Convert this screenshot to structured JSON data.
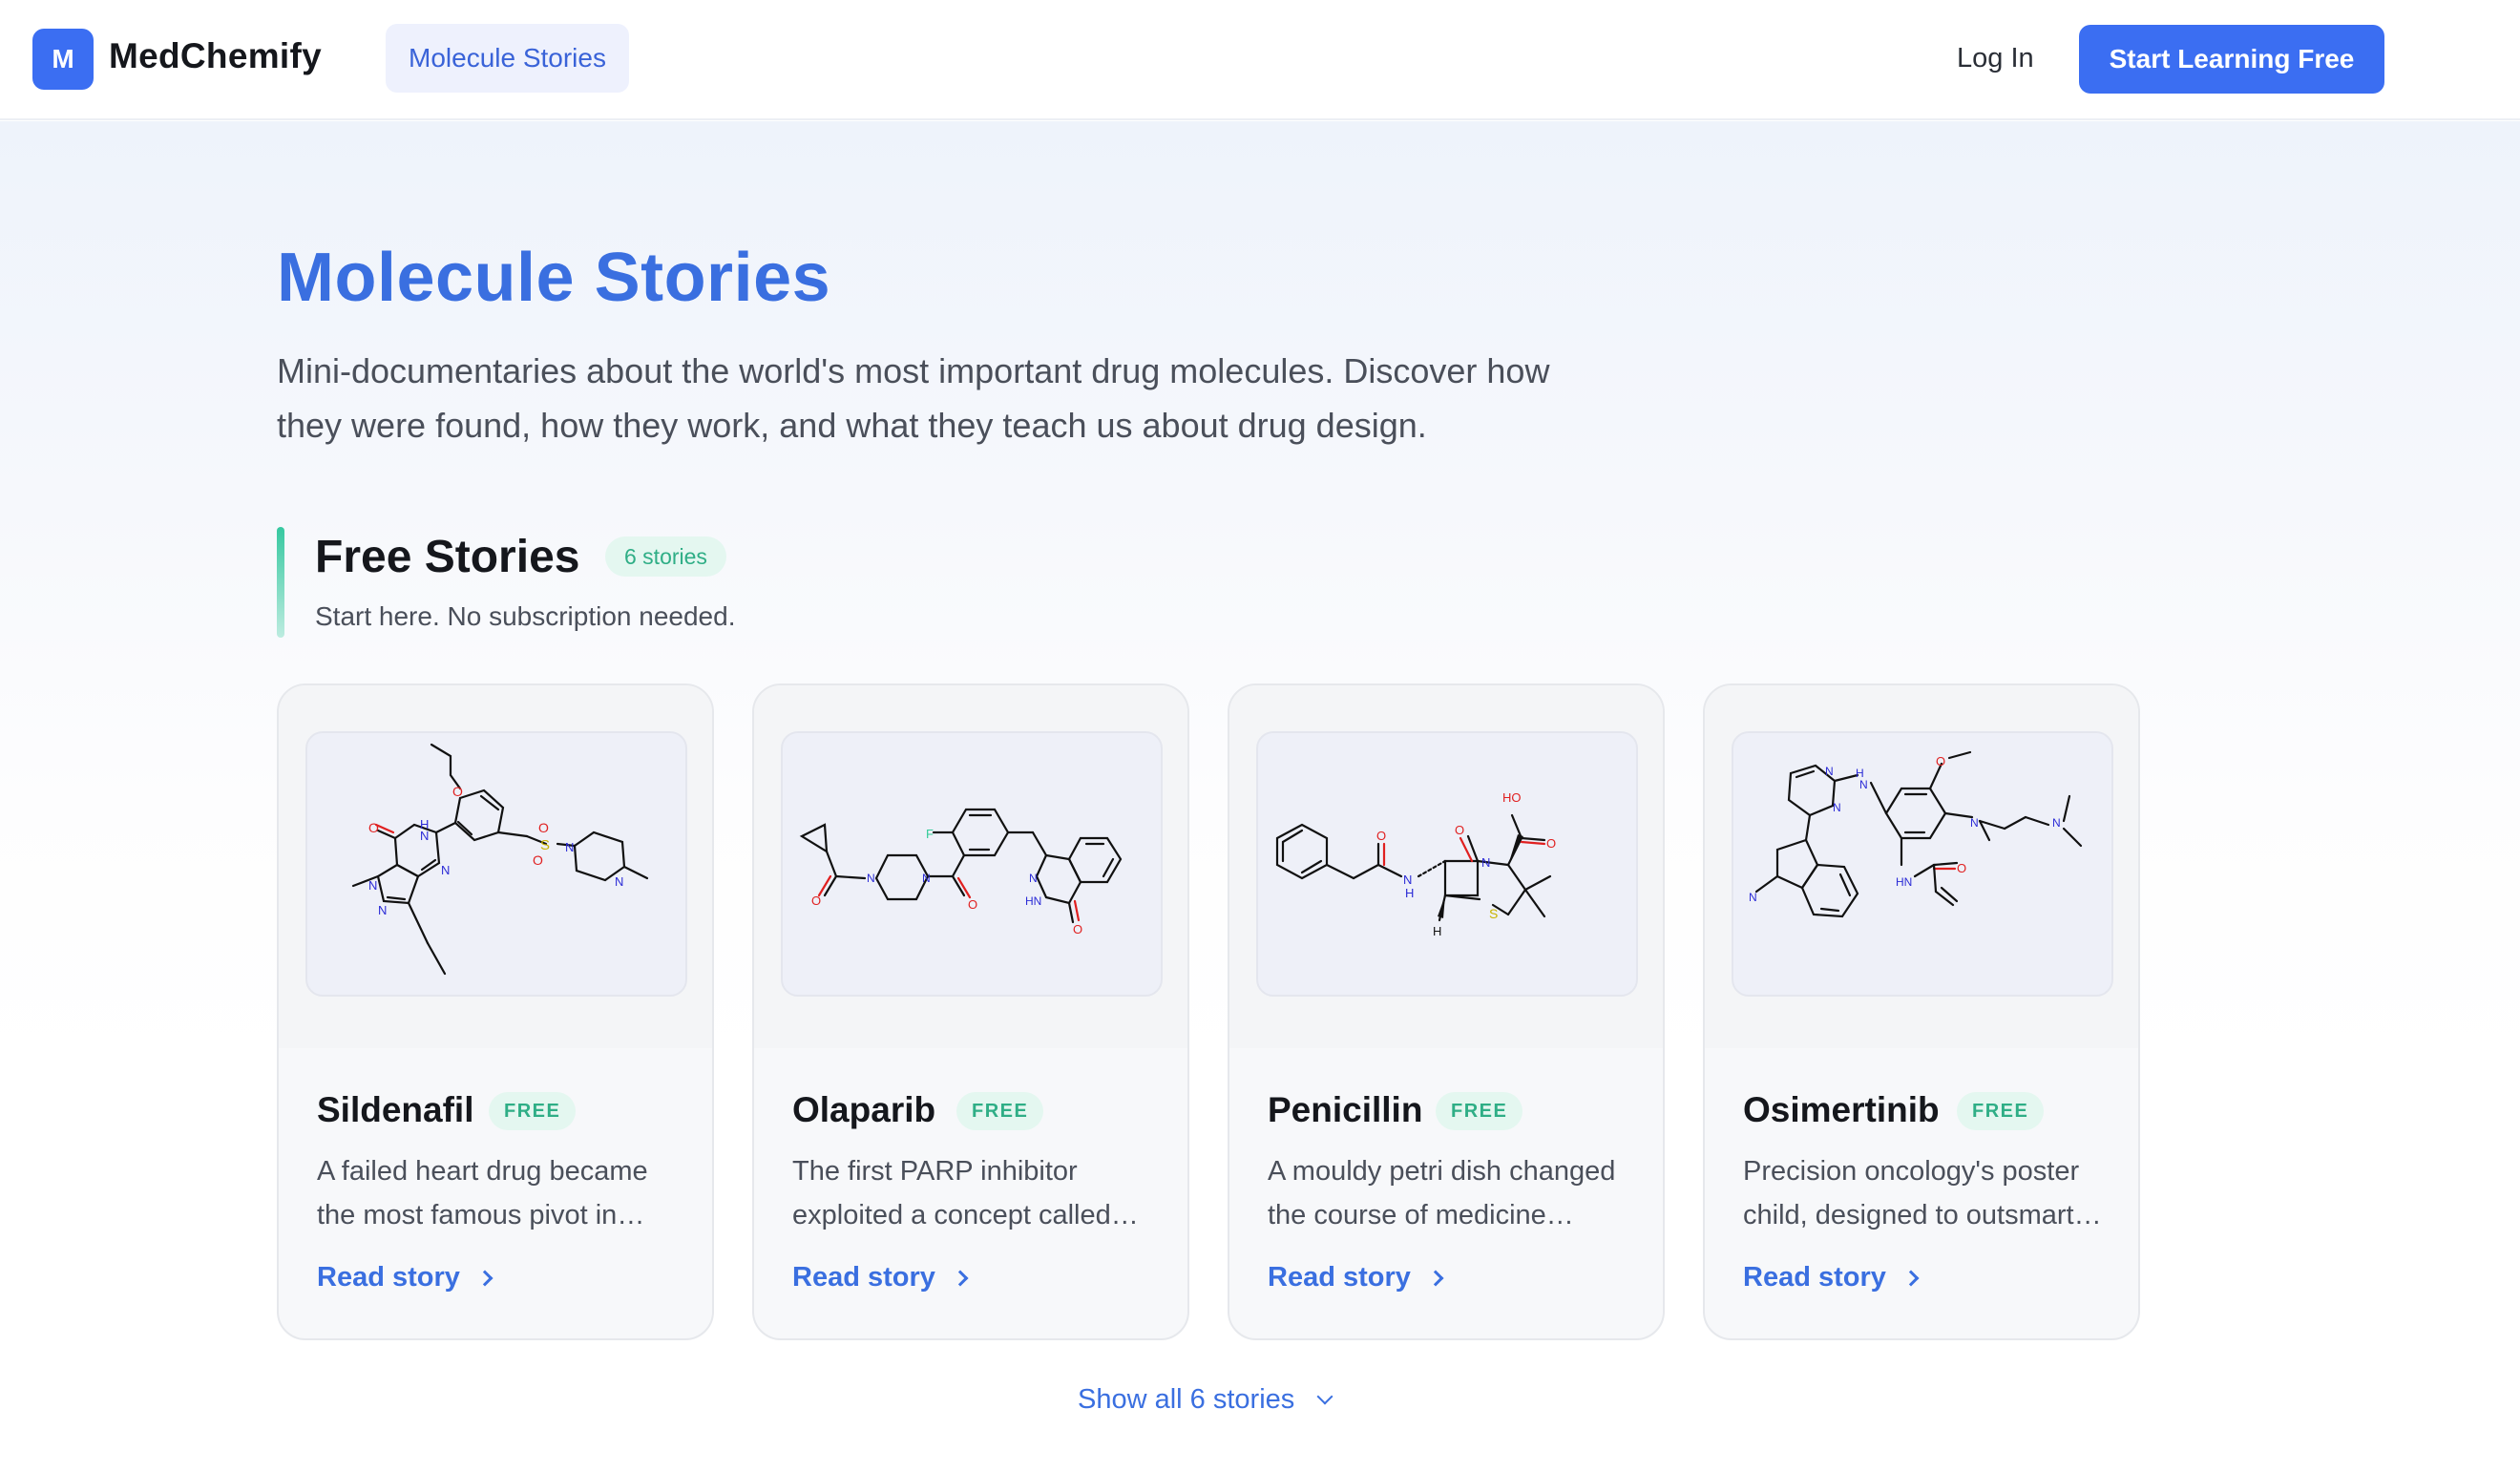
{
  "header": {
    "logo_letter": "M",
    "brand": "MedChemify",
    "nav_active": "Molecule Stories",
    "login": "Log In",
    "cta": "Start Learning Free"
  },
  "hero": {
    "title": "Molecule Stories",
    "description": "Mini-documentaries about the world's most important drug molecules. Discover how they were found, how they work, and what they teach us about drug design."
  },
  "section": {
    "title": "Free Stories",
    "count": "6 stories",
    "subtitle": "Start here. No subscription needed."
  },
  "cards": [
    {
      "name": "Sildenafil",
      "badge": "FREE",
      "desc": "A failed heart drug became the most famous pivot in…",
      "link": "Read story"
    },
    {
      "name": "Olaparib",
      "badge": "FREE",
      "desc": "The first PARP inhibitor exploited a concept called…",
      "link": "Read story"
    },
    {
      "name": "Penicillin",
      "badge": "FREE",
      "desc": "A mouldy petri dish changed the course of medicine…",
      "link": "Read story"
    },
    {
      "name": "Osimertinib",
      "badge": "FREE",
      "desc": "Precision oncology's poster child, designed to outsmart…",
      "link": "Read story"
    }
  ],
  "show_all": "Show all 6 stories",
  "colors": {
    "primary": "#3b6ef2",
    "title": "#3a6fe0",
    "accent_green": "#2fae86",
    "nitrogen": "#2b2bd6",
    "oxygen": "#e02020",
    "sulfur": "#c9b400",
    "fluorine": "#33cc99"
  }
}
